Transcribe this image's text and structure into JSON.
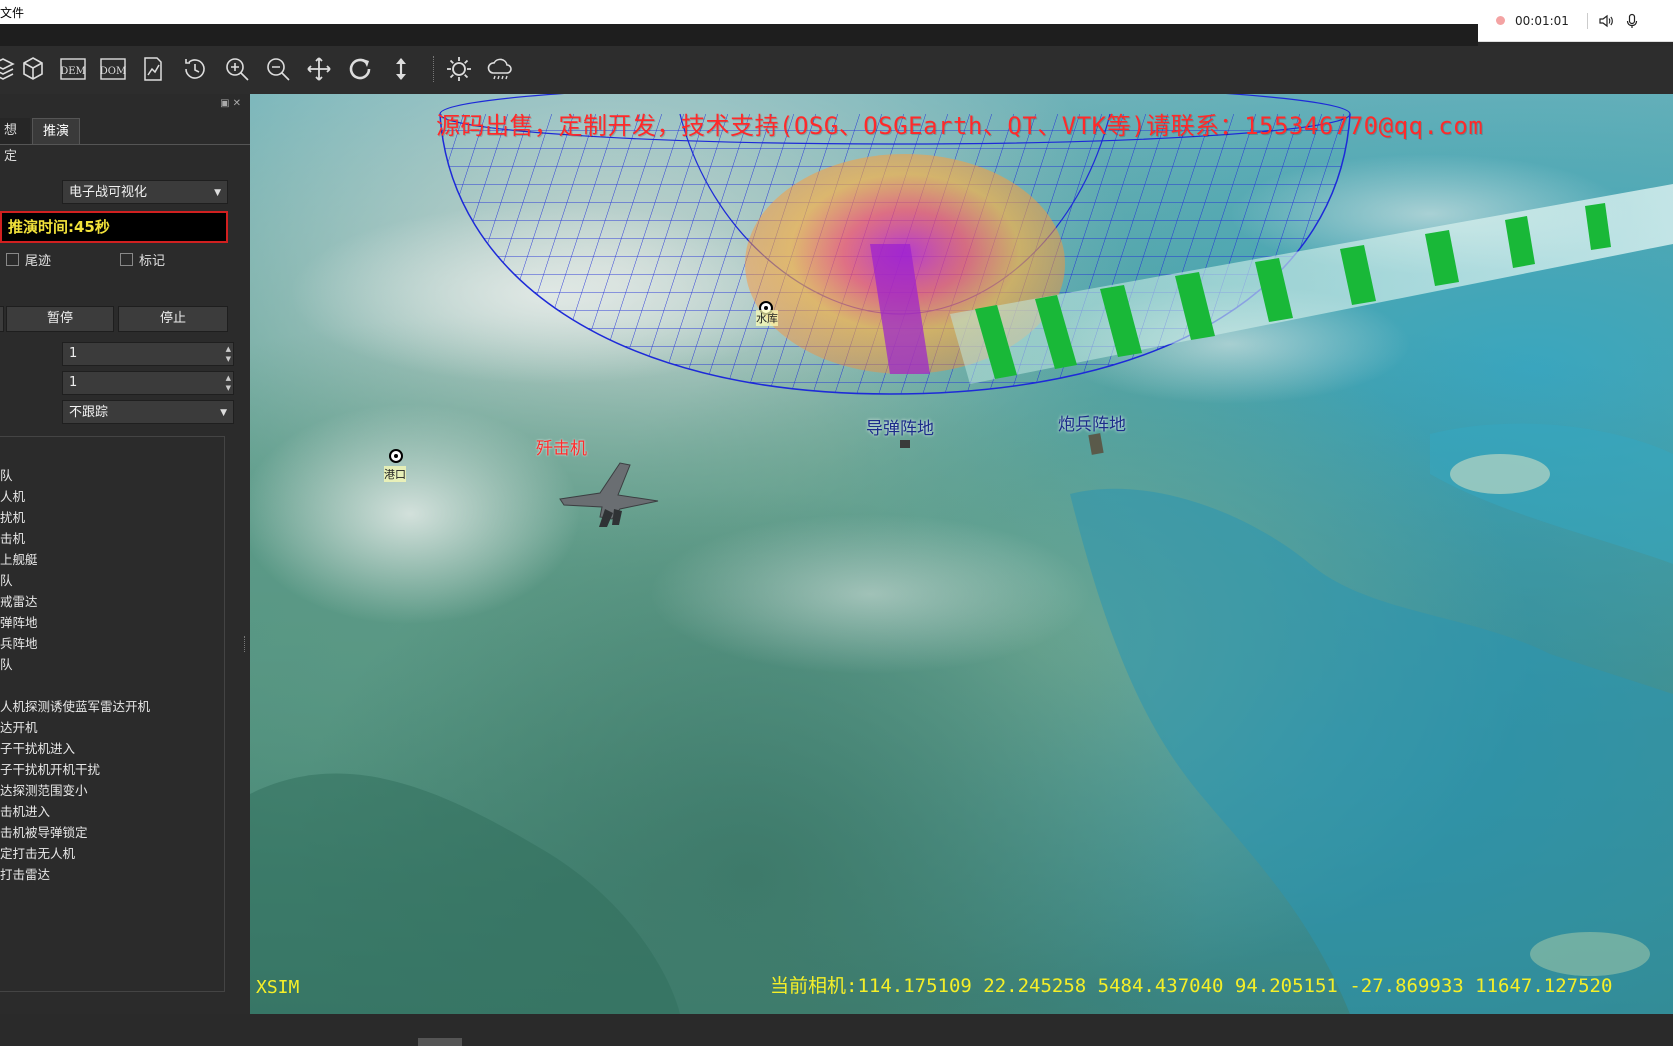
{
  "menubar": {
    "file_label": "文件"
  },
  "recorder": {
    "time": "00:01:01"
  },
  "toolbar": {
    "icons": [
      "stack-icon",
      "cube-icon",
      "dem-icon",
      "dom-icon",
      "chart-icon",
      "history-icon",
      "zoom-in-icon",
      "zoom-out-icon",
      "pan-icon",
      "refresh-icon",
      "vertical-move-icon",
      "sun-icon",
      "cloud-rain-icon"
    ],
    "dem_text": "DEM",
    "dom_text": "DOM"
  },
  "panel": {
    "tab_fixed": "想定",
    "tab_fixed_visible": "想定",
    "tab_deduce": "推演",
    "mode_select": "电子战可视化",
    "time_display": "推演时间:45秒",
    "checkbox_trail": "尾迹",
    "checkbox_mark": "标记",
    "pause_label": "暂停",
    "stop_label": "停止",
    "spin1": "1",
    "spin2": "1",
    "track_select": "不跟踪",
    "list_units": [
      "队",
      "人机",
      "扰机",
      "击机",
      "上舰艇",
      "队",
      "戒雷达",
      "弹阵地",
      "兵阵地",
      "队"
    ],
    "list_events": [
      "人机探测诱使蓝军雷达开机",
      "达开机",
      "子干扰机进入",
      "子干扰机开机干扰",
      "达探测范围变小",
      "击机进入",
      "击机被导弹锁定",
      "定打击无人机",
      "打击雷达"
    ]
  },
  "viewport": {
    "watermark": "源码出售，定制开发，技术支持(OSG、OSGEarth、QT、VTK等)请联系：155346770@qq.com",
    "label_fighter": "歼击机",
    "label_missile": "导弹阵地",
    "label_artillery": "炮兵阵地",
    "label_port": "港口",
    "label_reservoir": "水库",
    "xsim": "XSIM",
    "camera": "当前相机:114.175109 22.245258 5484.437040 94.205151 -27.869933 11647.127520"
  },
  "colors": {
    "accent_red": "#d12020",
    "time_text": "#f2e23a",
    "radar_blue": "#1d2ad8",
    "beam_green": "#19b838",
    "hud_yellow": "#f5ef28"
  }
}
